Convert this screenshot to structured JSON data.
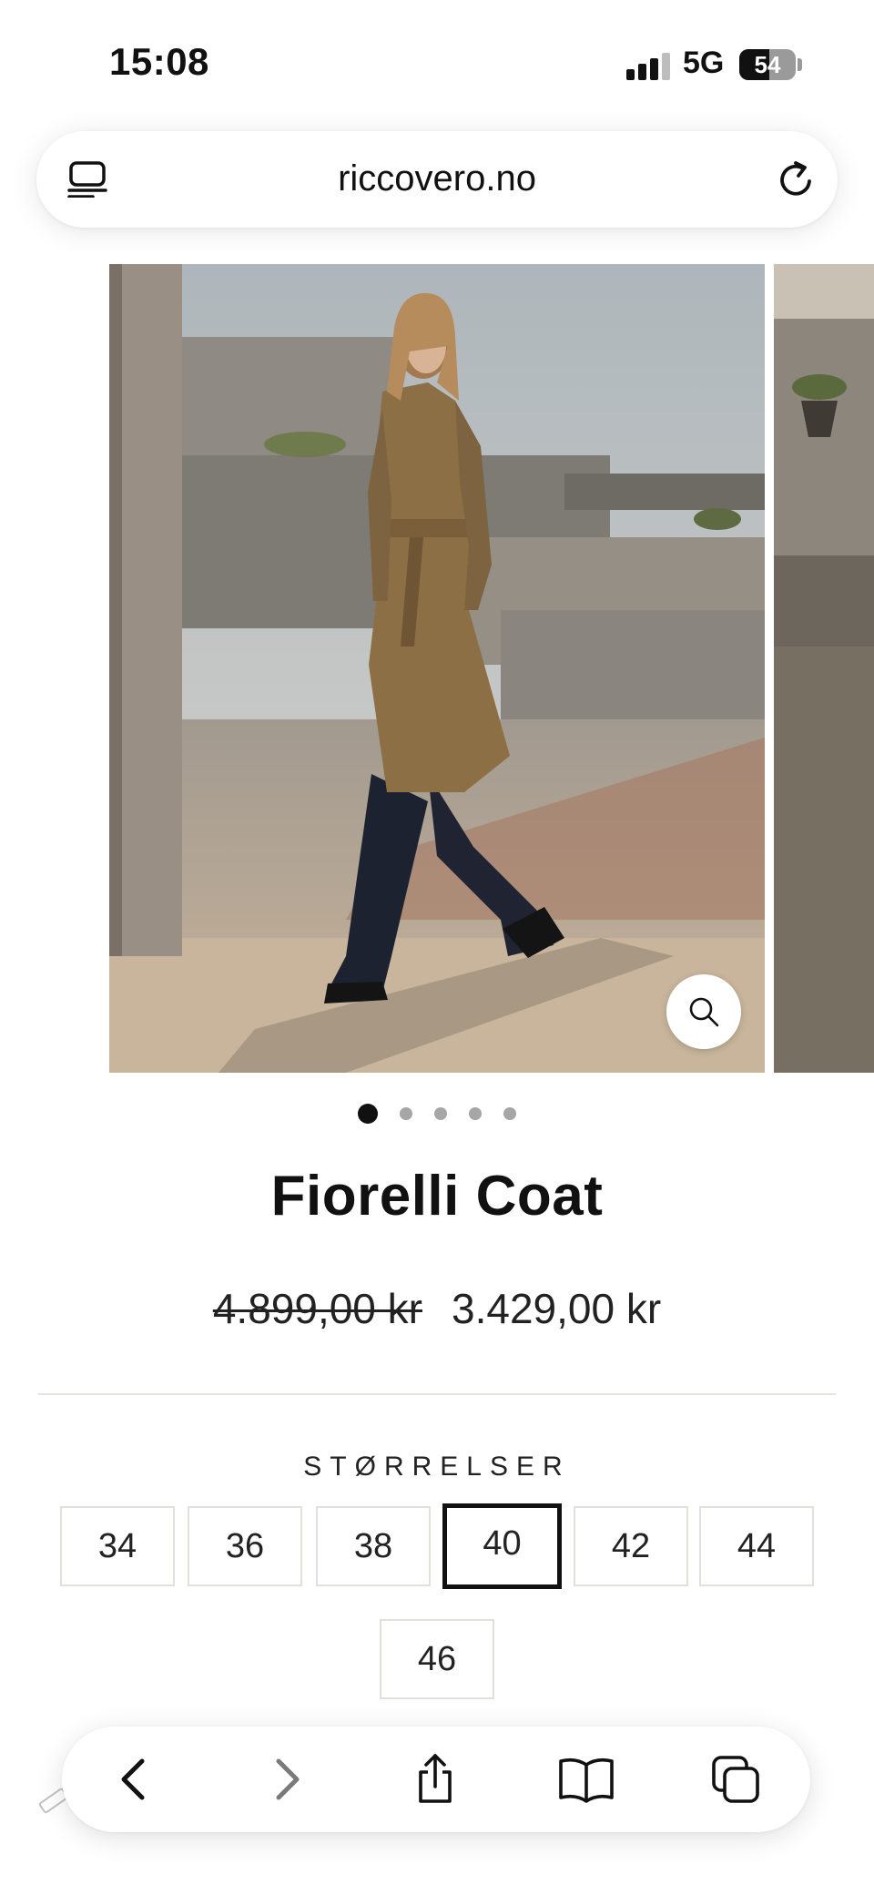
{
  "status_bar": {
    "time": "15:08",
    "network": "5G",
    "battery": "54",
    "battery_level": 0.54
  },
  "browser": {
    "url": "riccovero.no",
    "reader_icon": "reader-mode-icon",
    "reload_icon": "reload-icon"
  },
  "gallery": {
    "slide_count": 5,
    "active_index": 0,
    "zoom_icon": "magnifier-icon"
  },
  "product": {
    "title": "Fiorelli Coat",
    "old_price": "4.899,00 kr",
    "price": "3.429,00 kr"
  },
  "sizes": {
    "label": "STØRRELSER",
    "options": [
      "34",
      "36",
      "38",
      "40",
      "42",
      "44",
      "46"
    ],
    "selected": "40"
  },
  "toolbar": {
    "icons": [
      "back-icon",
      "forward-icon",
      "share-icon",
      "bookmarks-icon",
      "tabs-icon"
    ]
  },
  "colors": {
    "text": "#111111",
    "divider": "#e6e3dc",
    "size_border": "#e2e0da"
  }
}
